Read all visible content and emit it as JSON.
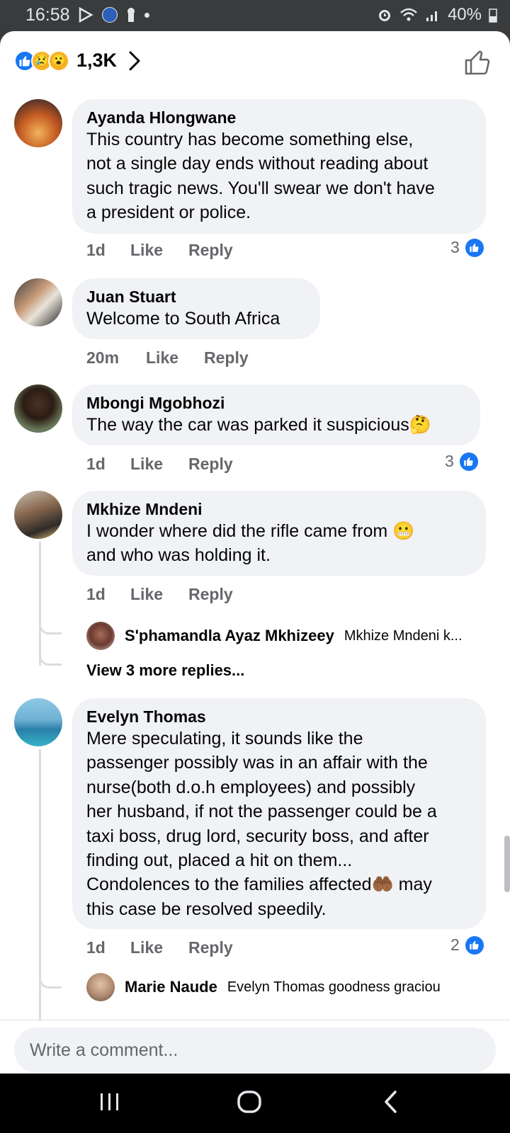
{
  "status_bar": {
    "time": "16:58",
    "battery": "40%"
  },
  "header": {
    "reaction_count": "1,3K"
  },
  "comments": [
    {
      "author": "Ayanda Hlongwane",
      "lines": [
        "This country has become something else,",
        "not a single day ends without reading about",
        "such tragic news. You'll swear we don't have",
        "a president or police."
      ],
      "time": "1d",
      "like": "Like",
      "reply": "Reply",
      "reactions": "3"
    },
    {
      "author": "Juan Stuart",
      "lines": [
        "Welcome to South Africa"
      ],
      "time": "20m",
      "like": "Like",
      "reply": "Reply"
    },
    {
      "author": "Mbongi Mgobhozi",
      "lines": [
        "The way the car was parked it suspicious🤔"
      ],
      "time": "1d",
      "like": "Like",
      "reply": "Reply",
      "reactions": "3"
    },
    {
      "author": "Mkhize Mndeni",
      "lines": [
        "I wonder where did the rifle came from 😬",
        "and who was holding it."
      ],
      "time": "1d",
      "like": "Like",
      "reply": "Reply",
      "reply_preview": {
        "name": "S'phamandla Ayaz Mkhizeey",
        "text": "Mkhize Mndeni k..."
      },
      "view_more": "View 3 more replies..."
    },
    {
      "author": "Evelyn Thomas",
      "lines": [
        "Mere speculating, it sounds like the",
        "passenger possibly was in an affair with the",
        "nurse(both d.o.h employees) and possibly",
        "her husband, if not the passenger could be a",
        "taxi boss, drug lord, security boss, and after",
        "finding out, placed a hit on them...",
        "Condolences to the families affected🤲🏾 may",
        "this case be resolved speedily."
      ],
      "time": "1d",
      "like": "Like",
      "reply": "Reply",
      "reactions": "2",
      "reply_preview": {
        "name": "Marie Naude",
        "text": "Evelyn Thomas goodness graciou"
      }
    }
  ],
  "composer": {
    "placeholder": "Write a comment..."
  }
}
